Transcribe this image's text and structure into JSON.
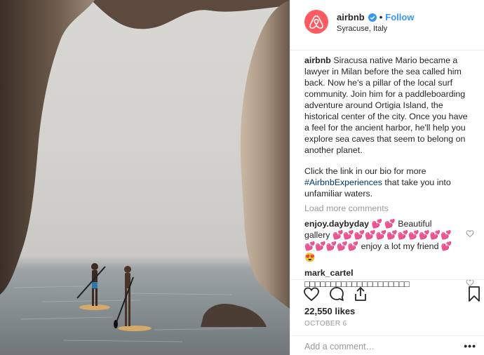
{
  "post": {
    "username": "airbnb",
    "follow_label": "Follow",
    "separator": "•",
    "location": "Syracuse, Italy",
    "verified": true,
    "brand_color": "#ff5a5f",
    "link_color": "#3897f0"
  },
  "caption": {
    "username": "airbnb",
    "text1": "Siracusa native Mario became a lawyer in Milan before the sea called him back. Now he's a pillar of the local surf community. Join him for a paddleboarding adventure around Ortigia Island, the historical center of the city. Once you have a feel for the ancient harbor, he'll help you explore sea caves that seem to belong on another planet.",
    "text2_before": "Click the link in our bio for more ",
    "hashtag": "#AirbnbExperiences",
    "text2_after": " that take you into unfamiliar waters."
  },
  "load_more_label": "Load more comments",
  "comments": [
    {
      "username": "enjoy.daybyday",
      "hearts_a": "💕 💕",
      "text_a": " Beautiful gallery ",
      "hearts_b": "💕💕💕💕💕💕💕💕💕💕💕💕💕💕💕💕",
      "text_b": " enjoy a lot my friend ",
      "hearts_c": "💕😍"
    },
    {
      "username": "mark_cartel",
      "text": "□□□□□□□□□□□□□□□□□□□□"
    }
  ],
  "likes": "22,550 likes",
  "date": "OCTOBER 6",
  "add_comment_placeholder": "Add a comment…",
  "more_label": "•••",
  "icons": [
    "airbnb-logo-icon",
    "verified-badge-icon",
    "heart-icon",
    "comment-icon",
    "share-icon",
    "bookmark-icon"
  ]
}
